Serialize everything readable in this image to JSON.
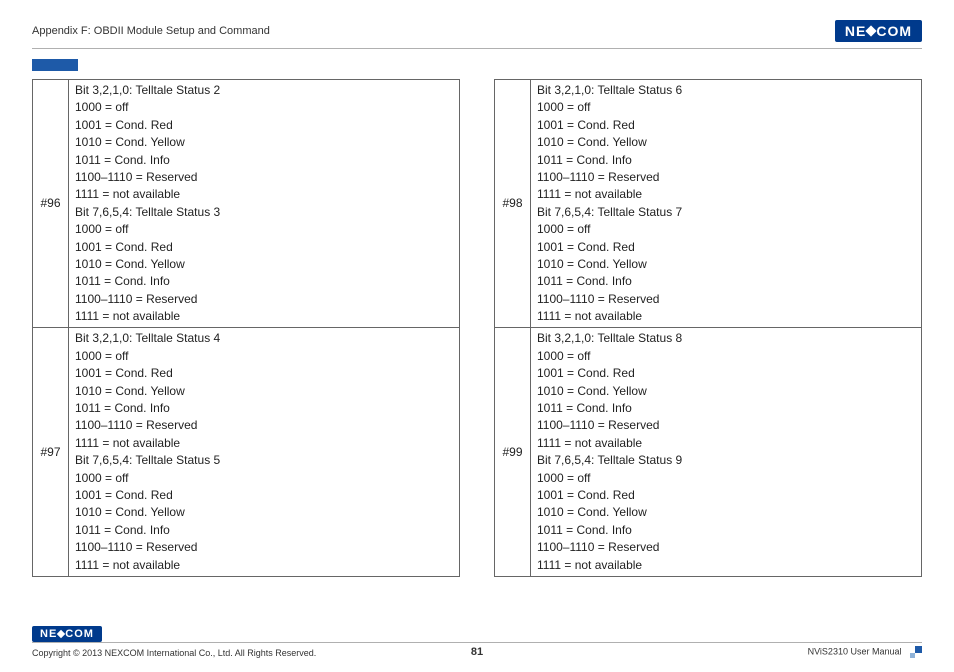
{
  "header": {
    "title": "Appendix F: OBDII Module Setup and Command",
    "logo_text_left": "NE",
    "logo_text_right": "COM"
  },
  "tables": {
    "left": [
      {
        "idx": "#96",
        "body": "Bit 3,2,1,0: Telltale Status 2\n1000 = off\n1001 = Cond. Red\n1010 = Cond. Yellow\n1011 = Cond. Info\n1100–1110 = Reserved\n1111 = not available\nBit 7,6,5,4: Telltale Status 3\n1000 = off\n1001 = Cond. Red\n1010 = Cond. Yellow\n1011 = Cond. Info\n1100–1110 = Reserved\n1111 = not available"
      },
      {
        "idx": "#97",
        "body": "Bit 3,2,1,0: Telltale Status 4\n1000 = off\n1001 = Cond. Red\n1010 = Cond. Yellow\n1011 = Cond. Info\n1100–1110 = Reserved\n1111 = not available\nBit 7,6,5,4: Telltale Status 5\n1000 = off\n1001 = Cond. Red\n1010 = Cond. Yellow\n1011 = Cond. Info\n1100–1110 = Reserved\n1111 = not available"
      }
    ],
    "right": [
      {
        "idx": "#98",
        "body": "Bit 3,2,1,0: Telltale Status 6\n1000 = off\n1001 = Cond. Red\n1010 = Cond. Yellow\n1011 = Cond. Info\n1100–1110 = Reserved\n1111 = not available\nBit 7,6,5,4: Telltale Status 7\n1000 = off\n1001 = Cond. Red\n1010 = Cond. Yellow\n1011 = Cond. Info\n1100–1110 = Reserved\n1111 = not available"
      },
      {
        "idx": "#99",
        "body": "Bit 3,2,1,0: Telltale Status 8\n1000 = off\n1001 = Cond. Red\n1010 = Cond. Yellow\n1011 = Cond. Info\n1100–1110 = Reserved\n1111 = not available\nBit 7,6,5,4: Telltale Status 9\n1000 = off\n1001 = Cond. Red\n1010 = Cond. Yellow\n1011 = Cond. Info\n1100–1110 = Reserved\n1111 = not available"
      }
    ]
  },
  "footer": {
    "copyright": "Copyright © 2013 NEXCOM International Co., Ltd. All Rights Reserved.",
    "page_number": "81",
    "manual": "NViS2310 User Manual",
    "logo_text_left": "NE",
    "logo_text_right": "COM"
  }
}
